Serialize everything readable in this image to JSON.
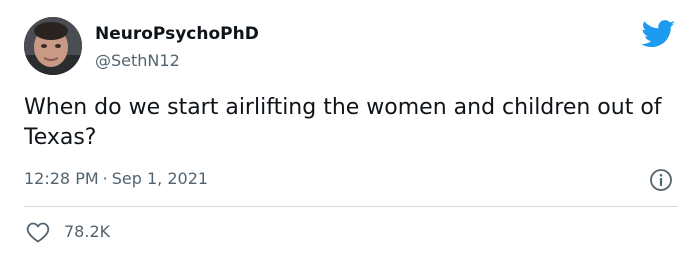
{
  "tweet": {
    "display_name": "NeuroPsychoPhD",
    "handle": "@SethN12",
    "text": "When do we start airlifting the women and children out of Texas?",
    "time": "12:28 PM",
    "separator": "·",
    "date": "Sep 1, 2021",
    "likes": "78.2K"
  },
  "icons": {
    "brand": "twitter-bird-icon",
    "info": "info-icon",
    "like": "heart-icon"
  },
  "colors": {
    "brand_blue": "#1d9bf0",
    "text_primary": "#0f1419",
    "text_secondary": "#536471",
    "divider": "#cfd9de"
  }
}
